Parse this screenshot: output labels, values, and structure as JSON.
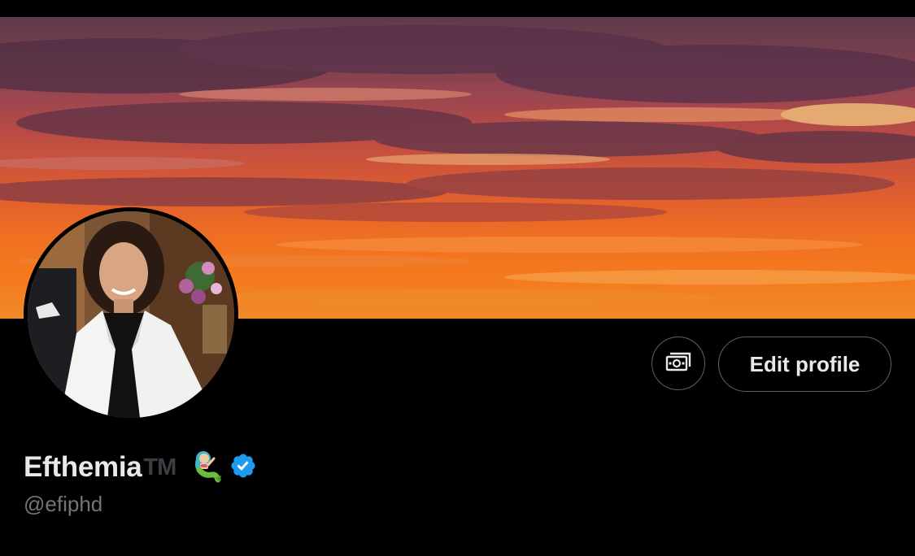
{
  "profile": {
    "display_name": "Efthemia",
    "name_suffix": "TM",
    "name_emoji": "mermaid-emoji",
    "verified": true,
    "handle": "@efiphd"
  },
  "actions": {
    "edit_profile_label": "Edit profile",
    "cash_icon": "money-icon"
  },
  "banner": {
    "description_icon": "sunset-header-image"
  },
  "colors": {
    "background": "#000000",
    "primary_text": "#e7e9ea",
    "secondary_text": "#71767b",
    "button_border": "#536471",
    "verified_blue": "#1d9bf0"
  }
}
